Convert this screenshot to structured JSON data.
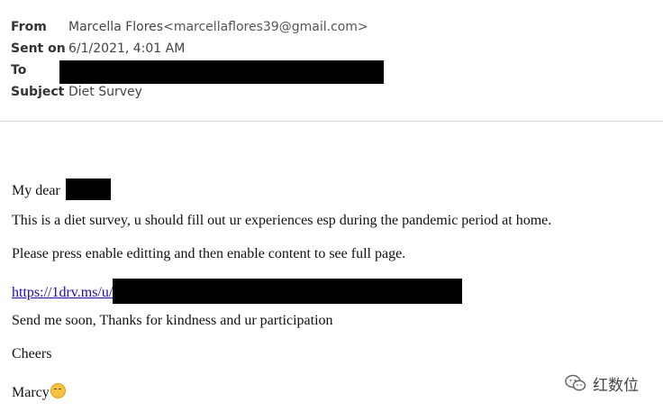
{
  "header": {
    "from_label": "From",
    "from_name": "Marcella Flores",
    "from_email": "<marcellaflores39@gmail.com>",
    "sent_label": "Sent on",
    "sent_value": "6/1/2021, 4:01 AM",
    "to_label": "To",
    "subject_label": "Subject",
    "subject_value": "Diet Survey"
  },
  "message": {
    "greeting": "My dear",
    "line1": "This is a diet survey, u should fill out ur experiences esp during the pandemic period at home.",
    "line2": "Please press enable editting and then enable content to see full page.",
    "link_text": "https://1drv.ms/u/",
    "line3": "Send me soon, Thanks for kindness and ur participation",
    "closing": "Cheers",
    "signature": "Marcy"
  },
  "watermark": {
    "text": "红数位",
    "icon": "wechat-icon"
  },
  "colors": {
    "link": "#1a0dab",
    "redaction": "#000000",
    "divider": "#d9d9d9"
  }
}
